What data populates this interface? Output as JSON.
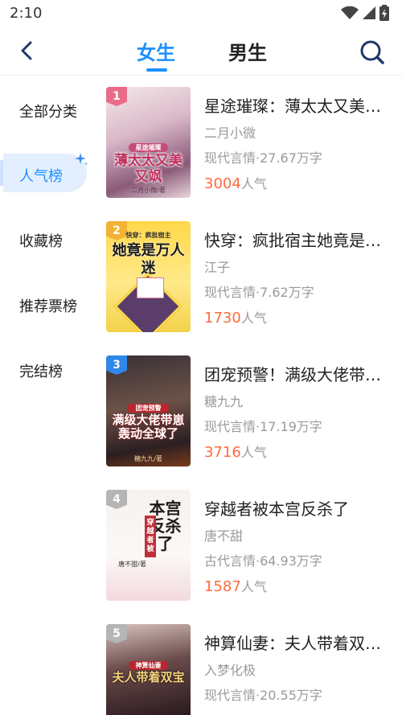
{
  "status_bar": {
    "time": "2:10"
  },
  "header": {
    "tabs": [
      {
        "label": "女生",
        "active": true
      },
      {
        "label": "男生",
        "active": false
      }
    ]
  },
  "sidebar": {
    "items": [
      {
        "label": "全部分类",
        "active": false
      },
      {
        "label": "人气榜",
        "active": true
      },
      {
        "label": "收藏榜",
        "active": false
      },
      {
        "label": "推荐票榜",
        "active": false
      },
      {
        "label": "完结榜",
        "active": false
      }
    ]
  },
  "books": [
    {
      "rank": "1",
      "title": "星途璀璨：薄太太又美…",
      "author": "二月小微",
      "genre": "现代言情",
      "words": "27.67万字",
      "popularity": "3004",
      "pop_unit": "人气",
      "cover_text": "薄太太又美又飒",
      "cover_sub": "星途璀璨",
      "cover_author": "二月小微/著"
    },
    {
      "rank": "2",
      "title": "快穿：疯批宿主她竟是…",
      "author": "江子",
      "genre": "现代言情",
      "words": "7.62万字",
      "popularity": "1730",
      "pop_unit": "人气",
      "cover_text": "她竟是万人迷",
      "cover_sub": "快穿：疯批宿主",
      "cover_author": ""
    },
    {
      "rank": "3",
      "title": "团宠预警！满级大佬带…",
      "author": "糖九九",
      "genre": "现代言情",
      "words": "17.19万字",
      "popularity": "3716",
      "pop_unit": "人气",
      "cover_text": "满级大佬带崽轰动全球了",
      "cover_sub": "团宠预警",
      "cover_author": "糖九九/著"
    },
    {
      "rank": "4",
      "title": "穿越者被本宫反杀了",
      "author": "唐不甜",
      "genre": "古代言情",
      "words": "64.93万字",
      "popularity": "1587",
      "pop_unit": "人气",
      "cover_text": "本宫反杀了",
      "cover_sub": "穿越者被",
      "cover_author": "唐不甜/著"
    },
    {
      "rank": "5",
      "title": "神算仙妻：夫人带着双…",
      "author": "入梦化极",
      "genre": "现代言情",
      "words": "20.55万字",
      "popularity": "",
      "pop_unit": "",
      "cover_text": "夫人带着双宝",
      "cover_sub": "神算仙妻",
      "cover_author": ""
    }
  ],
  "colors": {
    "accent": "#1e90ff",
    "popularity": "#ff6a3d",
    "muted_text": "#9a9a9a",
    "rank_1": "#e96b8a",
    "rank_2": "#f2b233",
    "rank_3": "#2f87e8",
    "rank_other": "#b5b5b5"
  },
  "icons": {
    "back": "chevron-left-icon",
    "search": "search-icon",
    "wifi": "wifi-icon",
    "signal": "signal-icon",
    "battery": "battery-icon",
    "sparkle": "sparkle-icon"
  }
}
